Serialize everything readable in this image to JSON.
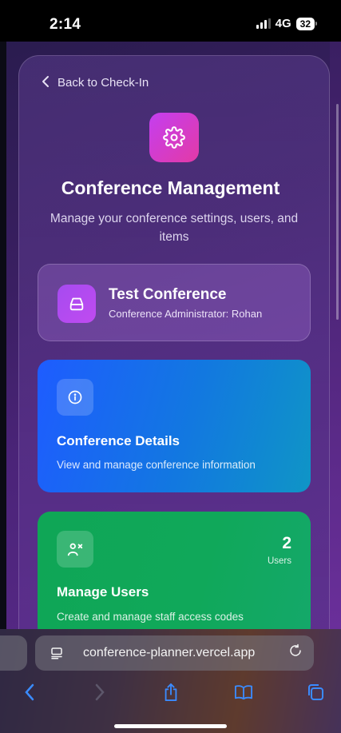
{
  "status": {
    "time": "2:14",
    "network": "4G",
    "battery": "32"
  },
  "nav": {
    "back_label": "Back to Check-In"
  },
  "header": {
    "title": "Conference Management",
    "subtitle": "Manage your conference settings, users, and items"
  },
  "conference": {
    "name": "Test Conference",
    "admin": "Conference Administrator: Rohan"
  },
  "cards": {
    "details": {
      "title": "Conference Details",
      "desc": "View and manage conference information"
    },
    "users": {
      "title": "Manage Users",
      "desc": "Create and manage staff access codes",
      "count": "2",
      "count_label": "Users"
    }
  },
  "browser": {
    "url": "conference-planner.vercel.app"
  },
  "icons": {
    "hero": "gear-icon",
    "conference": "inbox-icon",
    "details": "info-icon",
    "users": "users-icon",
    "back": "chevron-left-icon"
  },
  "colors": {
    "accent_pink": "#e33aa6",
    "details_blue": "#1e5cff",
    "users_green": "#0fa656",
    "browser_blue": "#3a8bff"
  }
}
